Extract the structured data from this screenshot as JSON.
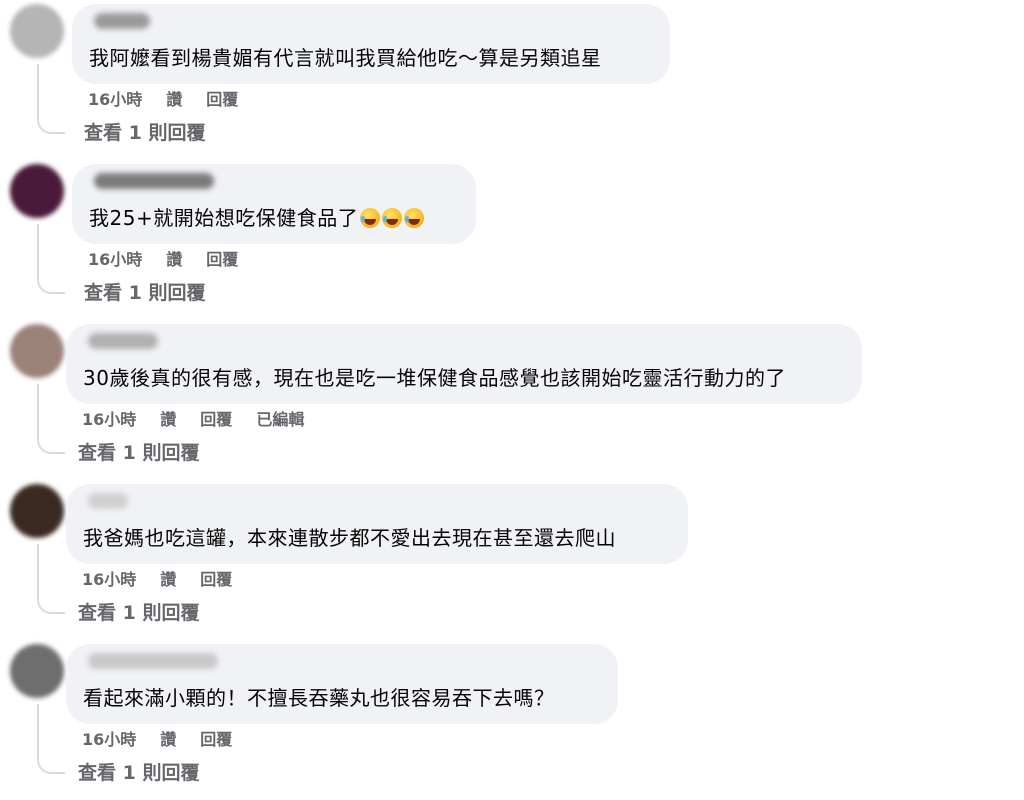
{
  "comments": [
    {
      "avatar_color": "#b5b5b5",
      "name_blur_color": "#9a9a9a",
      "text": "我阿嬤看到楊貴媚有代言就叫我買給他吃～算是另類追星",
      "emoji_count": 0,
      "time": "16小時",
      "like_label": "讚",
      "reply_label": "回覆",
      "edited_label": "",
      "view_replies": "查看 1 則回覆"
    },
    {
      "avatar_color": "#4a1a3a",
      "name_blur_color": "#7a7a7a",
      "text": "我25+就開始想吃保健食品了",
      "emoji_count": 3,
      "emoji_name": "rolling-on-floor-laughing-emoji",
      "time": "16小時",
      "like_label": "讚",
      "reply_label": "回覆",
      "edited_label": "",
      "view_replies": "查看 1 則回覆"
    },
    {
      "avatar_color": "#9b8279",
      "name_blur_color": "#b0b0b0",
      "text": "30歲後真的很有感，現在也是吃一堆保健食品感覺也該開始吃靈活行動力的了",
      "emoji_count": 0,
      "time": "16小時",
      "like_label": "讚",
      "reply_label": "回覆",
      "edited_label": "已編輯",
      "view_replies": "查看 1 則回覆"
    },
    {
      "avatar_color": "#3a2a22",
      "name_blur_color": "#d0d0d0",
      "text": "我爸媽也吃這罐，本來連散步都不愛出去現在甚至還去爬山",
      "emoji_count": 0,
      "time": "16小時",
      "like_label": "讚",
      "reply_label": "回覆",
      "edited_label": "",
      "view_replies": "查看 1 則回覆"
    },
    {
      "avatar_color": "#6e6e6e",
      "name_blur_color": "#c8c8c8",
      "text": "看起來滿小顆的！不擅長吞藥丸也很容易吞下去嗎？",
      "emoji_count": 0,
      "time": "16小時",
      "like_label": "讚",
      "reply_label": "回覆",
      "edited_label": "",
      "view_replies": "查看 1 則回覆"
    }
  ]
}
